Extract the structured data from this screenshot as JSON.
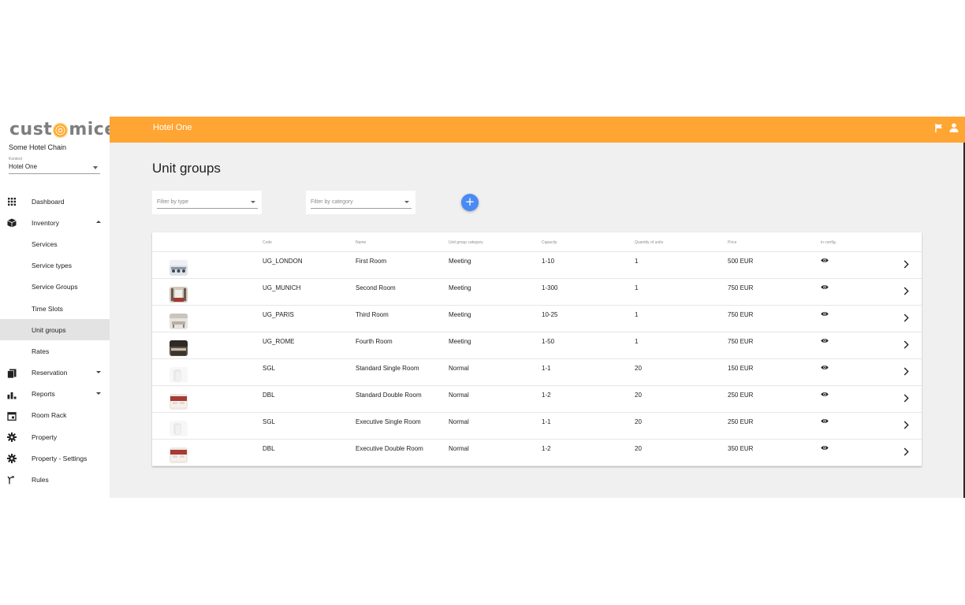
{
  "sidebar": {
    "logo_left": "cust",
    "logo_right": "mice",
    "chain_name": "Some Hotel Chain",
    "context_label": "Kontext",
    "context_value": "Hotel One",
    "items": [
      {
        "label": "Dashboard",
        "icon": "apps-icon"
      },
      {
        "label": "Inventory",
        "icon": "box-icon",
        "caret": "up"
      },
      {
        "label": "Services",
        "sub": true
      },
      {
        "label": "Service types",
        "sub": true
      },
      {
        "label": "Service Groups",
        "sub": true
      },
      {
        "label": "Time Slots",
        "sub": true
      },
      {
        "label": "Unit groups",
        "sub": true,
        "active": true
      },
      {
        "label": "Rates",
        "sub": true
      },
      {
        "label": "Reservation",
        "icon": "copy-icon",
        "caret": "down"
      },
      {
        "label": "Reports",
        "icon": "bar-chart-icon",
        "caret": "down"
      },
      {
        "label": "Room Rack",
        "icon": "calendar-icon"
      },
      {
        "label": "Property",
        "icon": "gear-icon"
      },
      {
        "label": "Property - Settings",
        "icon": "gear-icon"
      },
      {
        "label": "Rules",
        "icon": "fork-icon"
      }
    ]
  },
  "header": {
    "title": "Hotel One",
    "color": "#ffa533"
  },
  "page": {
    "title": "Unit groups",
    "filter_type_placeholder": "Filter by type",
    "filter_category_placeholder": "Filter by category",
    "add_label": "+"
  },
  "table": {
    "columns": [
      "Code",
      "Name",
      "Unit group category",
      "Capacity",
      "Quantity of units",
      "Price",
      "in config."
    ],
    "rows": [
      {
        "code": "UG_LONDON",
        "name": "First Room",
        "category": "Meeting",
        "capacity": "1-10",
        "quantity": "1",
        "price": "500 EUR",
        "thumb": "meeting-a"
      },
      {
        "code": "UG_MUNICH",
        "name": "Second Room",
        "category": "Meeting",
        "capacity": "1-300",
        "quantity": "1",
        "price": "750 EUR",
        "thumb": "meeting-b"
      },
      {
        "code": "UG_PARIS",
        "name": "Third Room",
        "category": "Meeting",
        "capacity": "10-25",
        "quantity": "1",
        "price": "750 EUR",
        "thumb": "meeting-c"
      },
      {
        "code": "UG_ROME",
        "name": "Fourth Room",
        "category": "Meeting",
        "capacity": "1-50",
        "quantity": "1",
        "price": "750 EUR",
        "thumb": "meeting-d"
      },
      {
        "code": "SGL",
        "name": "Standard Single Room",
        "category": "Normal",
        "capacity": "1-1",
        "quantity": "20",
        "price": "150 EUR",
        "thumb": "single"
      },
      {
        "code": "DBL",
        "name": "Standard Double Room",
        "category": "Normal",
        "capacity": "1-2",
        "quantity": "20",
        "price": "250 EUR",
        "thumb": "double"
      },
      {
        "code": "SGL",
        "name": "Executive Single Room",
        "category": "Normal",
        "capacity": "1-1",
        "quantity": "20",
        "price": "250 EUR",
        "thumb": "single"
      },
      {
        "code": "DBL",
        "name": "Executive Double Room",
        "category": "Normal",
        "capacity": "1-2",
        "quantity": "20",
        "price": "350 EUR",
        "thumb": "double"
      }
    ]
  }
}
